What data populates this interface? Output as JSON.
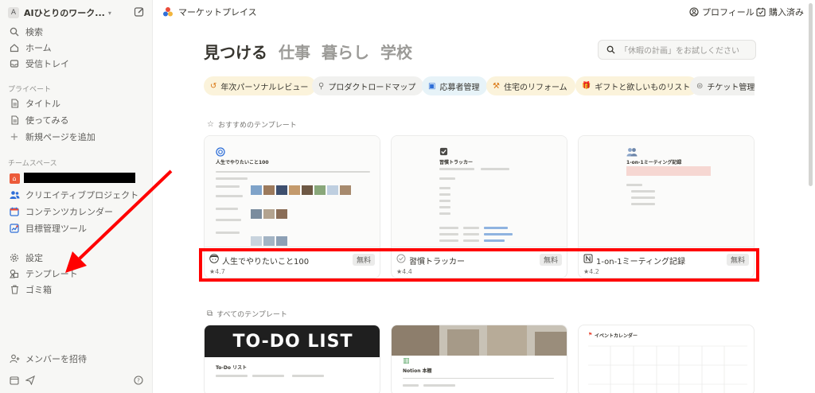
{
  "sidebar": {
    "workspace_initial": "A",
    "workspace_name": "AIひとりのワーク...",
    "nav": [
      {
        "label": "検索",
        "icon": "search-icon"
      },
      {
        "label": "ホーム",
        "icon": "home-icon"
      },
      {
        "label": "受信トレイ",
        "icon": "inbox-icon"
      }
    ],
    "private_header": "プライベート",
    "private_items": [
      {
        "label": "タイトル",
        "icon": "page-icon"
      },
      {
        "label": "使ってみる",
        "icon": "page-icon"
      },
      {
        "label": "新規ページを追加",
        "icon": "plus-icon"
      }
    ],
    "team_header": "チームスペース",
    "team_items": [
      {
        "label": "クリエイティブプロジェクト",
        "icon": "people-icon"
      },
      {
        "label": "コンテンツカレンダー",
        "icon": "calendar-icon"
      },
      {
        "label": "目標管理ツール",
        "icon": "chart-icon"
      }
    ],
    "bottom_items": [
      {
        "label": "設定",
        "icon": "gear-icon"
      },
      {
        "label": "テンプレート",
        "icon": "shapes-icon"
      },
      {
        "label": "ゴミ箱",
        "icon": "trash-icon"
      }
    ],
    "invite_label": "メンバーを招待"
  },
  "topbar": {
    "breadcrumb": "マーケットプレイス",
    "profile": "プロフィール",
    "purchased": "購入済み"
  },
  "main": {
    "tabs": [
      "見つける",
      "仕事",
      "暮らし",
      "学校"
    ],
    "search_placeholder": "「休暇の計画」をお試しください",
    "chips": [
      {
        "label": "年次パーソナルレビュー",
        "icon": "↺",
        "bg": "#fbf3db"
      },
      {
        "label": "プロダクトロードマップ",
        "icon": "⚲",
        "bg": "#f1f1ef"
      },
      {
        "label": "応募者管理",
        "icon": "▣",
        "bg": "#e7f3f8"
      },
      {
        "label": "住宅のリフォーム",
        "icon": "⚒",
        "bg": "#fbf3db"
      },
      {
        "label": "ギフトと欲しいものリスト",
        "icon": "🎁",
        "bg": "#fbf3db"
      },
      {
        "label": "チケット管理",
        "icon": "⊜",
        "bg": "#f1f1ef"
      }
    ],
    "featured_title": "おすすめのテンプレート",
    "featured": [
      {
        "title": "人生でやりたいこと100",
        "badge": "無料",
        "rating": "★4.7",
        "preview_title": "人生でやりたいこと100"
      },
      {
        "title": "習慣トラッカー",
        "badge": "無料",
        "rating": "★4.4",
        "preview_title": "習慣トラッカー"
      },
      {
        "title": "1-on-1ミーティング記録",
        "badge": "無料",
        "rating": "★4.2",
        "preview_title": "1-on-1ミーティング記録"
      }
    ],
    "all_title": "すべてのテンプレート",
    "all": [
      {
        "banner": "TO-DO LIST",
        "page_title": "To-Do リスト"
      },
      {
        "page_title": "Notion 本棚"
      },
      {
        "page_title": "イベントカレンダー"
      }
    ]
  },
  "colors": {
    "accent_red": "#ff0000",
    "sidebar_bg": "#f7f7f5"
  }
}
